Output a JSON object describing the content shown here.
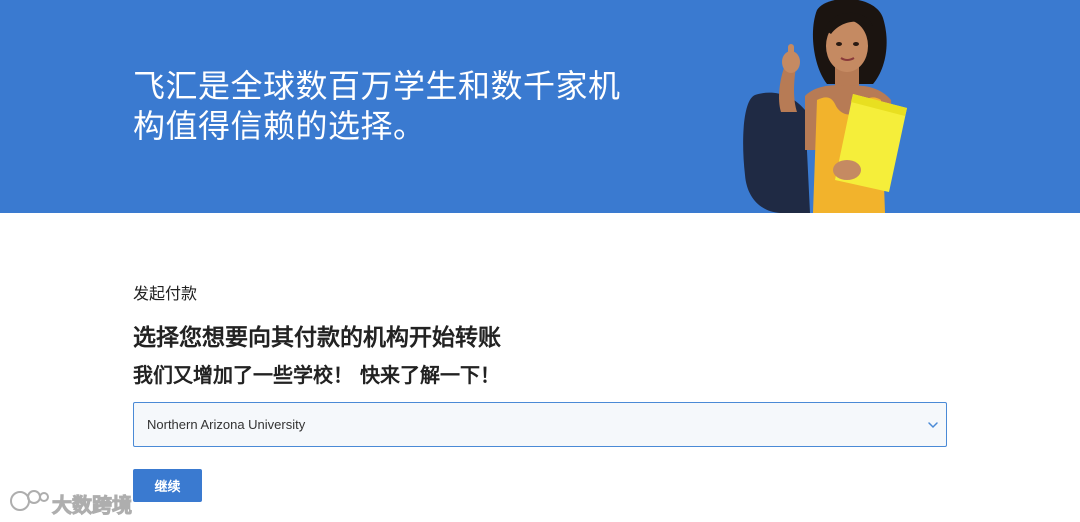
{
  "hero": {
    "title_line1": "飞汇是全球数百万学生和数千家机",
    "title_line2": "构值得信赖的选择。",
    "background_color": "#3a7ad0"
  },
  "payment": {
    "section_label": "发起付款",
    "heading": "选择您想要向其付款的机构开始转账",
    "subheading": "我们又增加了一些学校！ 快来了解一下！",
    "institution_select": {
      "selected_value": "Northern Arizona University",
      "icon": "chevron-down-icon"
    },
    "continue_label": "继续"
  },
  "watermark": {
    "text": "大数跨境",
    "icon": "logo-icon"
  }
}
